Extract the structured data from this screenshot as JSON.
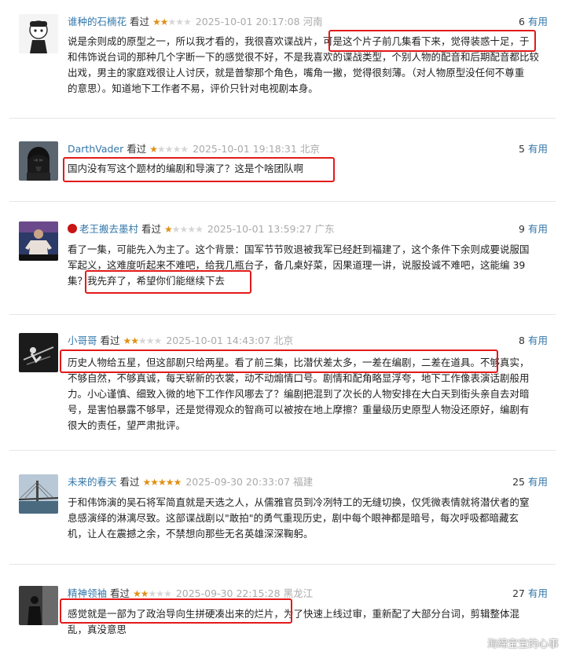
{
  "reviews": [
    {
      "username": "谁种的石楠花",
      "watched": "看过",
      "stars": 2,
      "time": "2025-10-01 20:17:08",
      "location": "河南",
      "useful_count": "6",
      "useful_label": "有用",
      "lines": [
        "说是余则成的原型之一，所以我才看的，我很喜欢谍战片，可是这个片子前几集看下来，觉得装惑十足，于",
        "和伟饰说台词的那种几个字断一下的感觉很不好，不是我喜欢的谍战类型，个别人物的配音和后期配音都比较",
        "出戏，男主的家庭戏很让人讨厌，就是普黎那个角色，嘴角一撇，觉得很刻薄。（对人物原型没任何不尊重",
        "的意思）。知道地下工作者不易，评价只针对电视剧本身。"
      ]
    },
    {
      "username": "DarthVader",
      "watched": "看过",
      "stars": 1,
      "time": "2025-10-01 19:18:31",
      "location": "北京",
      "useful_count": "5",
      "useful_label": "有用",
      "lines": [
        "国内没有写这个题材的编剧和导演了？这是个啥团队啊"
      ]
    },
    {
      "username": "老王搬去墨村",
      "watched": "看过",
      "stars": 1,
      "time": "2025-10-01 13:59:27",
      "location": "广东",
      "useful_count": "9",
      "useful_label": "有用",
      "lines": [
        "看了一集，可能先入为主了。这个背景：国军节节败退被我军已经赶到福建了，这个条件下余则成要说服国",
        "军起义，这难度听起来不难吧，给我几瓶台子，备几桌好菜，因果道理一讲，说服投诚不难吧，这能编 39",
        "集？我先弃了，希望你们能继续下去"
      ]
    },
    {
      "username": "小哥哥",
      "watched": "看过",
      "stars": 2,
      "time": "2025-10-01 14:43:07",
      "location": "北京",
      "useful_count": "8",
      "useful_label": "有用",
      "lines": [
        "历史人物给五星，但这部剧只给两星。看了前三集，比潜伏差太多，一差在编剧，二差在道具。不够真实，",
        "不够自然，不够真诚，每天崭新的衣裳，动不动煽情口号。剧情和配角略显浮夸，地下工作像表演话剧般用",
        "力。小心谨慎、细致入微的地下工作作风哪去了？编剧把混到了次长的人物安排在大白天到街头亲自去对暗",
        "号，是害怕暴露不够早，还是觉得观众的智商可以被按在地上摩擦？重量级历史原型人物没还原好，编剧有",
        "很大的责任，望严肃批评。"
      ]
    },
    {
      "username": "未来的春天",
      "watched": "看过",
      "stars": 5,
      "time": "2025-09-30 20:33:07",
      "location": "福建",
      "useful_count": "25",
      "useful_label": "有用",
      "lines": [
        "于和伟饰演的吴石将军简直就是天选之人，从儒雅官员到冷冽特工的无缝切换，仅凭微表情就将潜伏者的窒",
        "息感演绎的淋漓尽致。这部谍战剧以\"敢拍\"的勇气重现历史，剧中每个眼神都是暗号，每次呼吸都暗藏玄",
        "机，让人在震撼之余，不禁想向那些无名英雄深深鞠躬。"
      ]
    },
    {
      "username": "精神领袖",
      "watched": "看过",
      "stars": 2,
      "time": "2025-09-30 22:15:28",
      "location": "黑龙江",
      "useful_count": "27",
      "useful_label": "有用",
      "lines": [
        "感觉就是一部为了政治导向生拼硬凑出来的烂片，为了快速上线过审，重新配了大部分台词，剪辑整体混",
        "乱，真没意思"
      ]
    }
  ],
  "watermark": "海绵宝宝的心事",
  "colors": {
    "link": "#3377aa",
    "star": "#e09015",
    "highlight": "#e21a1a"
  },
  "icons": {
    "star_on": "★",
    "star_off": "★"
  }
}
